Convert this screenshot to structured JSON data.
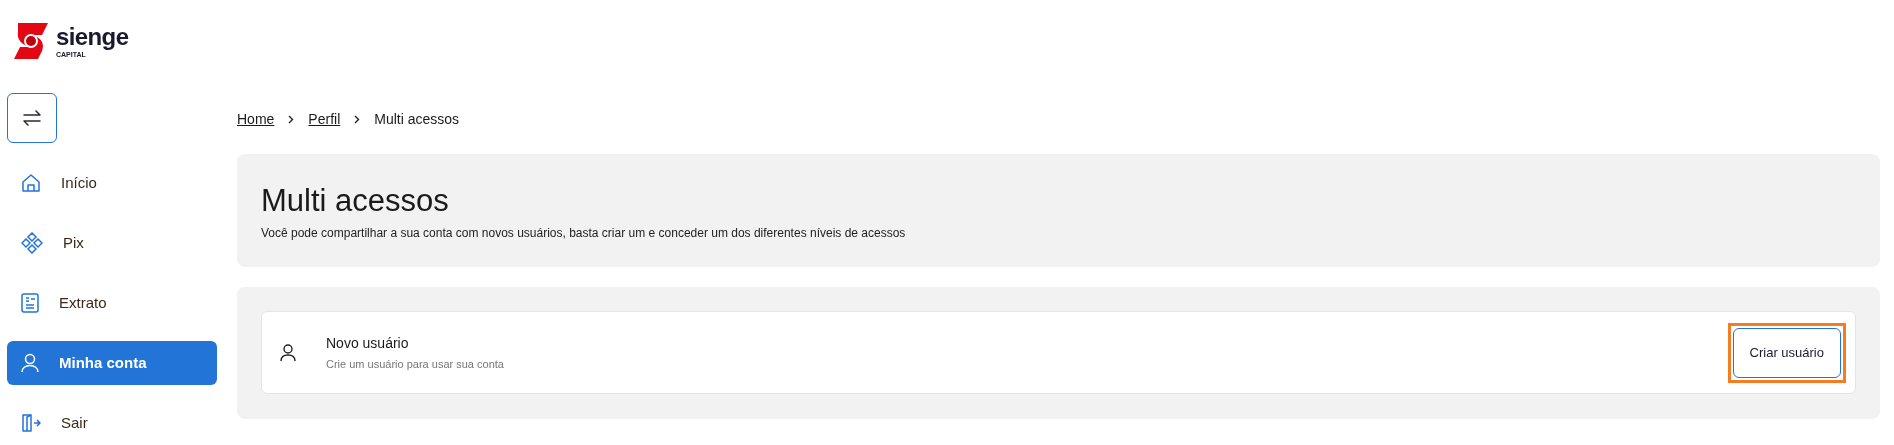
{
  "logo": {
    "name": "sienge",
    "tagline": "CAPITAL"
  },
  "sidebar": {
    "items": [
      {
        "kind": "home",
        "label": "Início",
        "selected": false
      },
      {
        "kind": "pix",
        "label": "Pix",
        "selected": false
      },
      {
        "kind": "statement",
        "label": "Extrato",
        "selected": false
      },
      {
        "kind": "account",
        "label": "Minha conta",
        "selected": true
      },
      {
        "kind": "logout",
        "label": "Sair",
        "selected": false
      }
    ]
  },
  "breadcrumb": [
    {
      "label": "Home",
      "link": true
    },
    {
      "label": "Perfil",
      "link": true
    },
    {
      "label": "Multi acessos",
      "link": false
    }
  ],
  "header": {
    "title": "Multi acessos",
    "description": "Você pode compartilhar a sua conta com novos usuários, basta criar um e conceder um dos diferentes níveis de acessos"
  },
  "new_user": {
    "title": "Novo usuário",
    "subtitle": "Crie um usuário para usar sua conta",
    "button": {
      "label": "Criar usuário",
      "highlighted": true
    }
  }
}
